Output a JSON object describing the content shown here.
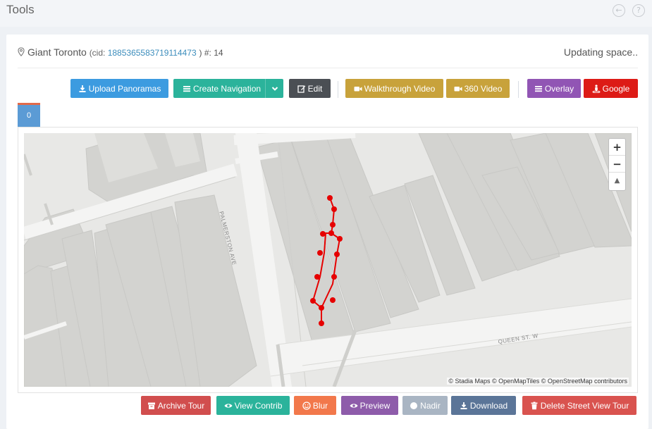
{
  "header": {
    "title": "Tools",
    "back_icon": "arrow-left-circle-icon",
    "help_icon": "question-circle-icon"
  },
  "tour": {
    "name": "Giant Toronto",
    "cid_label": "(cid: ",
    "cid_value": "1885365583719114473",
    "count_text": ") #: 14",
    "status": "Updating space.."
  },
  "toolbar": {
    "upload": "Upload Panoramas",
    "create_nav": "Create Navigation",
    "edit": "Edit",
    "walkthrough": "Walkthrough Video",
    "video360": "360 Video",
    "overlay": "Overlay",
    "google": "Google"
  },
  "tabs": [
    "0"
  ],
  "map": {
    "street_1": "PALMERSTON AVE",
    "street_2": "QUEEN ST. W",
    "zoom_in": "+",
    "zoom_out": "−",
    "reset": "▲",
    "attribution": "© Stadia Maps © OpenMapTiles © OpenStreetMap contributors",
    "route_color": "#e60000"
  },
  "footer": {
    "archive": "Archive Tour",
    "view_contrib": "View Contrib",
    "blur": "Blur",
    "preview": "Preview",
    "nadir": "Nadir",
    "download": "Download",
    "delete": "Delete Street View Tour"
  },
  "colors": {
    "primary": "#3c9be0",
    "teal": "#2bb39b",
    "gold": "#c8a23b",
    "danger": "#dd1b16"
  }
}
